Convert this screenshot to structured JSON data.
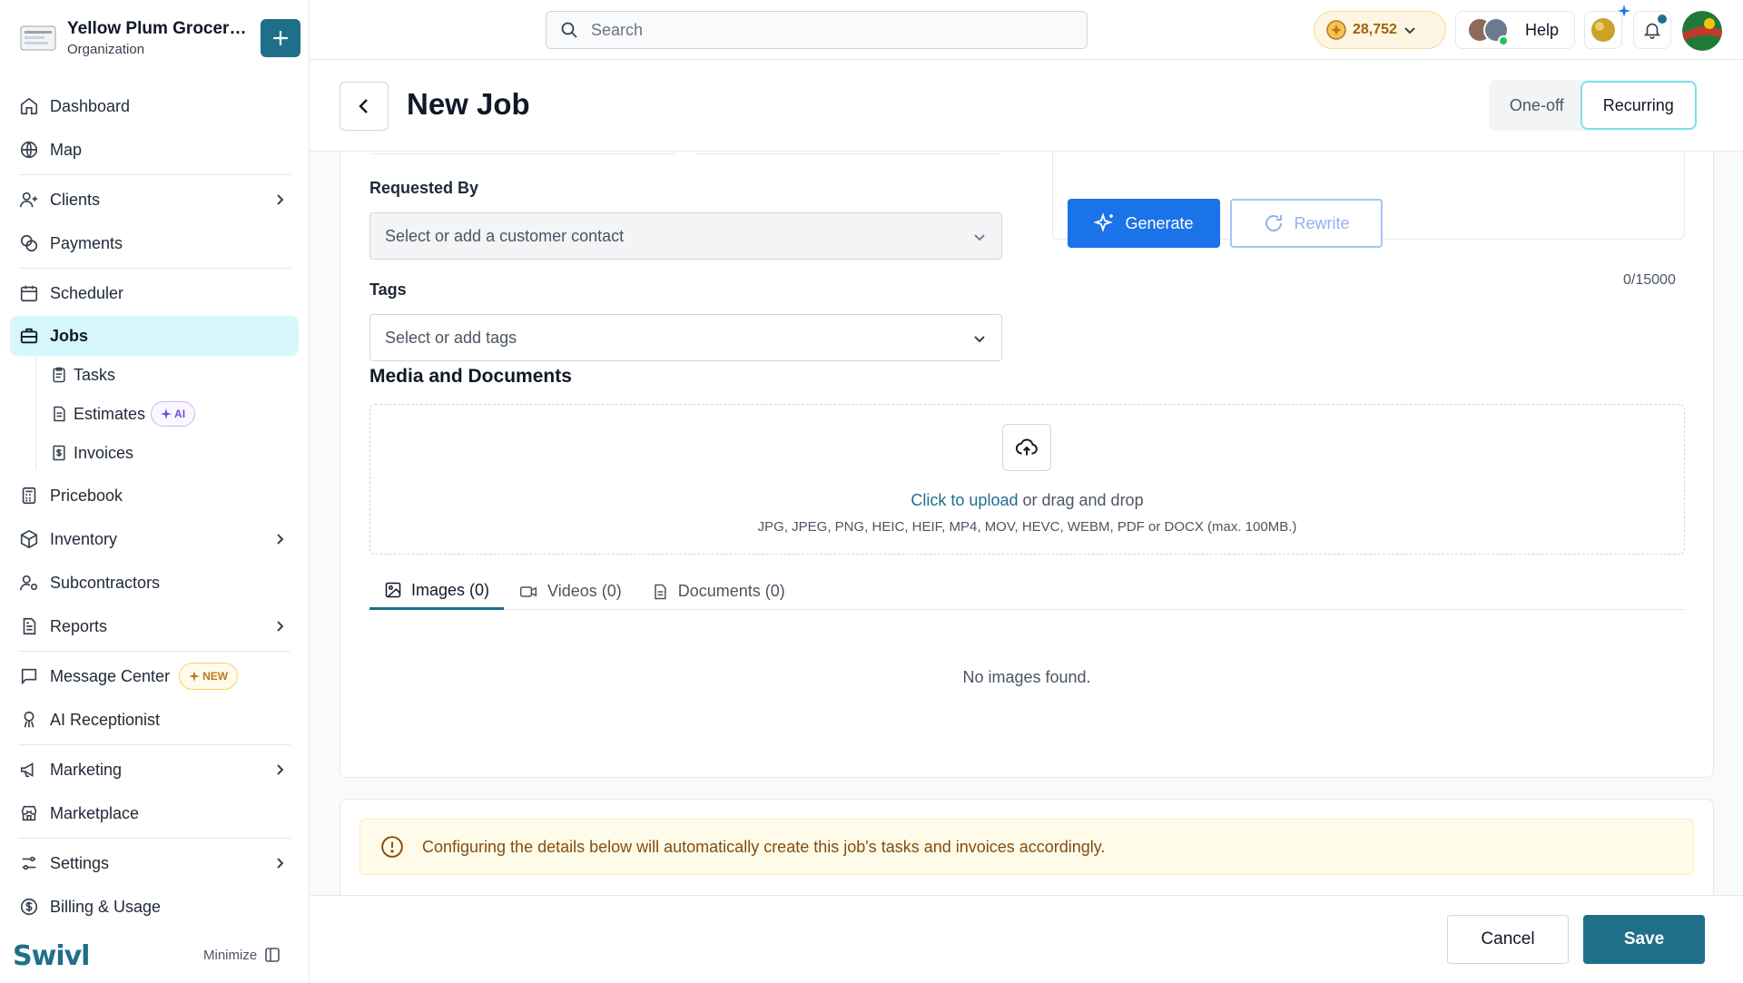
{
  "org": {
    "name": "Yellow Plum Grocers...",
    "subtitle": "Organization"
  },
  "sidebar": {
    "items": [
      {
        "label": "Dashboard"
      },
      {
        "label": "Map"
      },
      {
        "label": "Clients"
      },
      {
        "label": "Payments"
      },
      {
        "label": "Scheduler"
      },
      {
        "label": "Jobs"
      },
      {
        "label": "Pricebook"
      },
      {
        "label": "Inventory"
      },
      {
        "label": "Subcontractors"
      },
      {
        "label": "Reports"
      },
      {
        "label": "Message Center"
      },
      {
        "label": "AI Receptionist"
      },
      {
        "label": "Marketing"
      },
      {
        "label": "Marketplace"
      },
      {
        "label": "Settings"
      },
      {
        "label": "Billing & Usage"
      }
    ],
    "sub_items": [
      {
        "label": "Tasks"
      },
      {
        "label": "Estimates"
      },
      {
        "label": "Invoices"
      }
    ],
    "badge_ai": "AI",
    "badge_new": "NEW",
    "brand": "Swivl",
    "minimize": "Minimize"
  },
  "topbar": {
    "search_placeholder": "Search",
    "coins": "28,752",
    "help": "Help"
  },
  "page": {
    "title": "New Job",
    "segment": {
      "one_off": "One-off",
      "recurring": "Recurring",
      "selected": "Recurring"
    }
  },
  "form": {
    "requested_by_label": "Requested By",
    "requested_by_placeholder": "Select or add a customer contact",
    "tags_label": "Tags",
    "tags_placeholder": "Select or add tags",
    "generate": "Generate",
    "rewrite": "Rewrite",
    "char_counter": "0/15000"
  },
  "media": {
    "title": "Media and Documents",
    "upload_link": "Click to upload",
    "upload_rest": " or drag and drop",
    "formats": "JPG, JPEG, PNG, HEIC, HEIF, MP4, MOV, HEVC, WEBM, PDF or DOCX (max. 100MB.)",
    "tabs": [
      {
        "label": "Images (0)"
      },
      {
        "label": "Videos (0)"
      },
      {
        "label": "Documents (0)"
      }
    ],
    "empty": "No images found."
  },
  "notice": "Configuring the details below will automatically create this job's tasks and invoices accordingly.",
  "footer": {
    "cancel": "Cancel",
    "save": "Save"
  },
  "colors": {
    "primary": "#1f6f8b",
    "active_nav_bg": "#d6f7fb",
    "generate_blue": "#1a73e8",
    "notice_bg": "#fefbe8"
  }
}
